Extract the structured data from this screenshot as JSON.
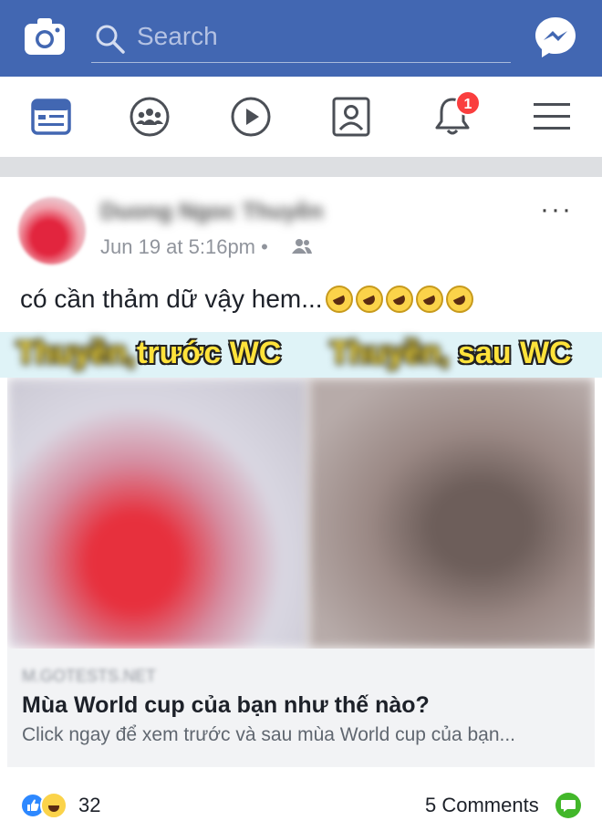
{
  "topbar": {
    "search_placeholder": "Search",
    "camera_icon": "camera-icon",
    "messenger_icon": "messenger-icon"
  },
  "nav": {
    "items": [
      "news-feed",
      "groups",
      "watch",
      "profile",
      "notifications",
      "menu"
    ],
    "notification_count": "1",
    "accent": "#4267b2"
  },
  "post": {
    "author": "Duong Ngoc Thuyền",
    "time": "Jun 19 at 5:16pm •",
    "more": "···",
    "caption": "có cần thảm dữ vậy hem...",
    "caption_emoji_count": 5,
    "banner": {
      "left_name": "Thuyền,",
      "left_text": "trước WC",
      "right_name": "Thuyền,",
      "right_text": "sau WC"
    },
    "link": {
      "domain": "M.GOTESTS.NET",
      "title": "Mùa World cup của bạn như thế nào?",
      "description": "Click ngay để xem trước và sau mùa World cup của bạn..."
    },
    "reactions_count": "32",
    "comments": "5 Comments"
  }
}
